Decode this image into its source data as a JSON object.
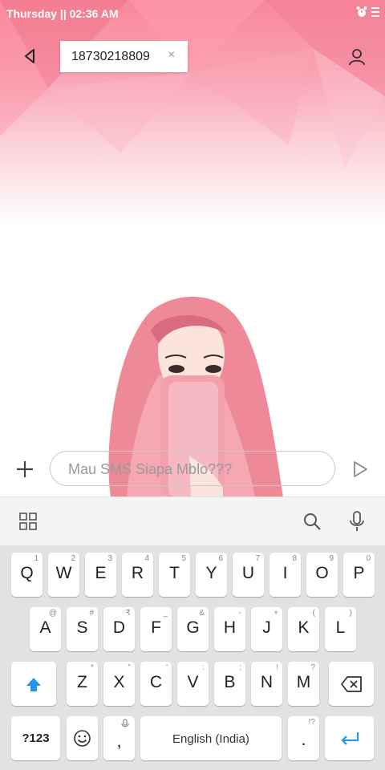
{
  "status_bar": {
    "time_text": "Thursday || 02:36 AM"
  },
  "header": {
    "recipient": "18730218809",
    "remove_glyph": "×"
  },
  "compose": {
    "placeholder": "Mau SMS Siapa Mblo???"
  },
  "keyboard": {
    "row1": [
      {
        "label": "Q",
        "hint": "1"
      },
      {
        "label": "W",
        "hint": "2"
      },
      {
        "label": "E",
        "hint": "3"
      },
      {
        "label": "R",
        "hint": "4"
      },
      {
        "label": "T",
        "hint": "5"
      },
      {
        "label": "Y",
        "hint": "6"
      },
      {
        "label": "U",
        "hint": "7"
      },
      {
        "label": "I",
        "hint": "8"
      },
      {
        "label": "O",
        "hint": "9"
      },
      {
        "label": "P",
        "hint": "0"
      }
    ],
    "row2": [
      {
        "label": "A",
        "hint": "@"
      },
      {
        "label": "S",
        "hint": "#"
      },
      {
        "label": "D",
        "hint": "₹"
      },
      {
        "label": "F",
        "hint": "_"
      },
      {
        "label": "G",
        "hint": "&"
      },
      {
        "label": "H",
        "hint": "-"
      },
      {
        "label": "J",
        "hint": "+"
      },
      {
        "label": "K",
        "hint": "("
      },
      {
        "label": "L",
        "hint": ")"
      }
    ],
    "row3": [
      {
        "label": "Z",
        "hint": "*"
      },
      {
        "label": "X",
        "hint": "\""
      },
      {
        "label": "C",
        "hint": "'"
      },
      {
        "label": "V",
        "hint": ":"
      },
      {
        "label": "B",
        "hint": ";"
      },
      {
        "label": "N",
        "hint": "!"
      },
      {
        "label": "M",
        "hint": "?"
      }
    ],
    "symbols_label": "?123",
    "comma_label": ",",
    "space_label": "English (India)",
    "period_label": ".",
    "period_hint": "!?"
  },
  "colors": {
    "accent": "#2196f3",
    "wallpaper_top": "#f7889a"
  }
}
